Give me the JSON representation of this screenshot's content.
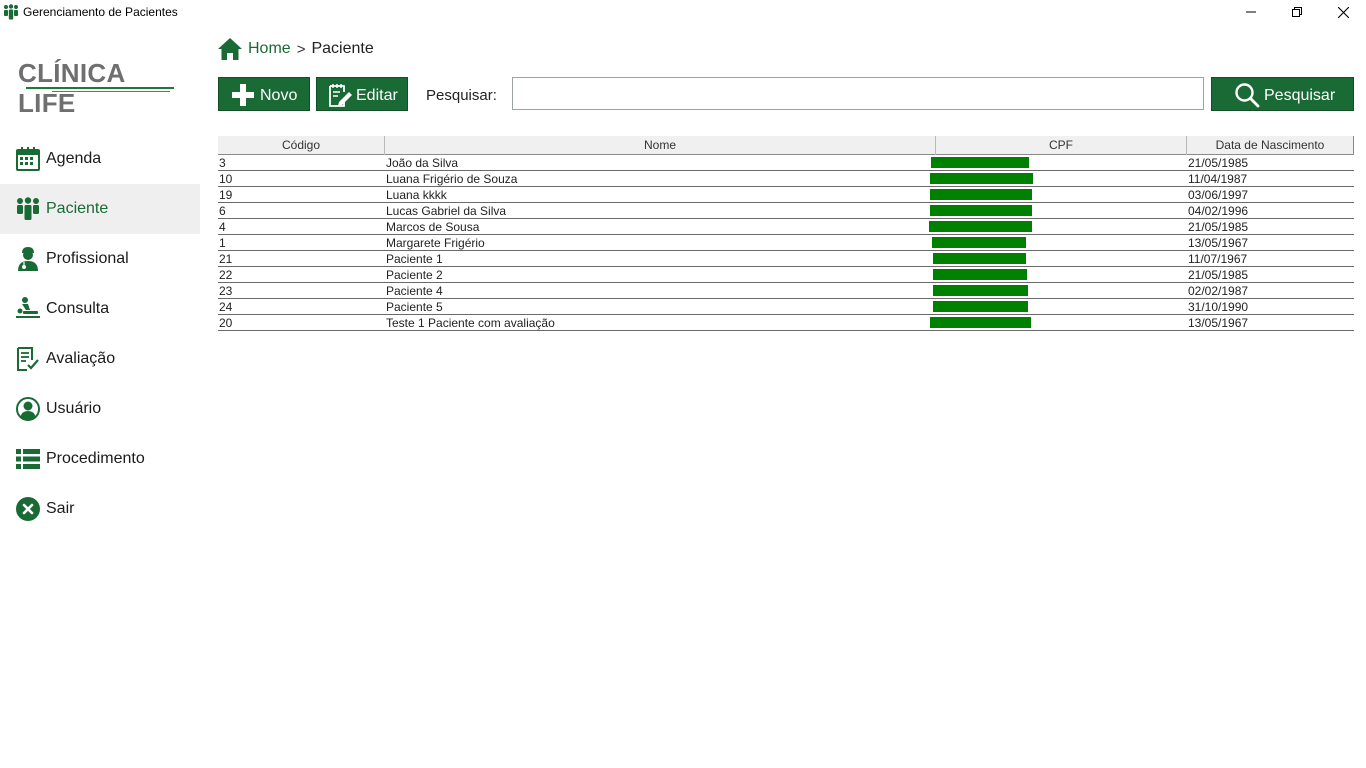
{
  "window": {
    "title": "Gerenciamento de Pacientes",
    "app_icon": "people-icon",
    "controls": [
      "minimize-icon",
      "restore-icon",
      "close-icon"
    ]
  },
  "logo": {
    "text": "CLÍNICA LIFE"
  },
  "colors": {
    "accent": "#1a6a35",
    "cpf_mask": "#008000",
    "active_bg": "#efefef"
  },
  "sidebar": {
    "items": [
      {
        "label": "Agenda",
        "icon": "calendar-icon",
        "active": false
      },
      {
        "label": "Paciente",
        "icon": "people-icon",
        "active": true
      },
      {
        "label": "Profissional",
        "icon": "doctor-icon",
        "active": false
      },
      {
        "label": "Consulta",
        "icon": "massage-icon",
        "active": false
      },
      {
        "label": "Avaliação",
        "icon": "checklist-icon",
        "active": false
      },
      {
        "label": "Usuário",
        "icon": "user-circle-icon",
        "active": false
      },
      {
        "label": "Procedimento",
        "icon": "list-icon",
        "active": false
      },
      {
        "label": "Sair",
        "icon": "close-circle-icon",
        "active": false
      }
    ]
  },
  "breadcrumb": {
    "home": "Home",
    "separator": ">",
    "current": "Paciente"
  },
  "toolbar": {
    "new_label": "Novo",
    "edit_label": "Editar",
    "search_label": "Pesquisar:",
    "search_value": "",
    "search_button": "Pesquisar"
  },
  "table": {
    "headers": {
      "codigo": "Código",
      "nome": "Nome",
      "cpf": "CPF",
      "data": "Data de Nascimento"
    },
    "rows": [
      {
        "codigo": "3",
        "nome": "João da Silva",
        "data": "21/05/1985"
      },
      {
        "codigo": "10",
        "nome": "Luana Frigério de Souza",
        "data": "11/04/1987"
      },
      {
        "codigo": "19",
        "nome": "Luana kkkk",
        "data": "03/06/1997"
      },
      {
        "codigo": "6",
        "nome": "Lucas Gabriel da Silva",
        "data": "04/02/1996"
      },
      {
        "codigo": "4",
        "nome": "Marcos de Sousa",
        "data": "21/05/1985"
      },
      {
        "codigo": "1",
        "nome": "Margarete Frigério",
        "data": "13/05/1967"
      },
      {
        "codigo": "21",
        "nome": "Paciente 1",
        "data": "11/07/1967"
      },
      {
        "codigo": "22",
        "nome": "Paciente 2",
        "data": "21/05/1985"
      },
      {
        "codigo": "23",
        "nome": "Paciente 4",
        "data": "02/02/1987"
      },
      {
        "codigo": "24",
        "nome": "Paciente 5",
        "data": "31/10/1990"
      },
      {
        "codigo": "20",
        "nome": "Teste 1 Paciente com avaliação",
        "data": "13/05/1967"
      }
    ]
  }
}
